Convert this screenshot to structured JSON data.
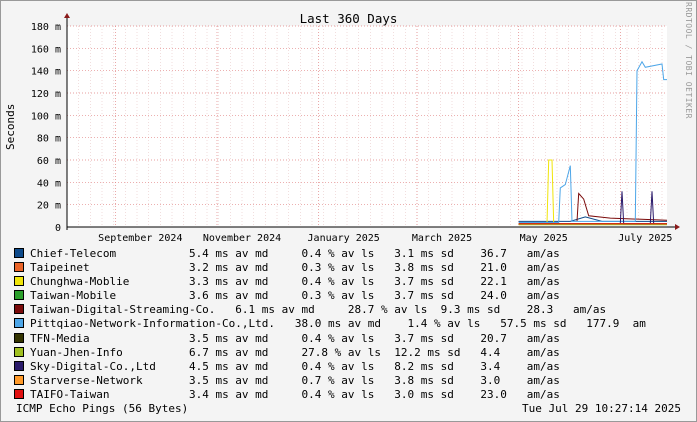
{
  "chart_data": {
    "type": "line",
    "title": "Last 360 Days",
    "ylabel": "Seconds",
    "watermark": "RRDTOOL / TOBI OETIKER",
    "ylim": [
      0,
      180
    ],
    "y_ticks": [
      "0",
      "20 m",
      "40 m",
      "60 m",
      "80 m",
      "100 m",
      "120 m",
      "140 m",
      "160 m",
      "180 m"
    ],
    "x_ticks": [
      "September 2024",
      "November 2024",
      "January 2025",
      "March 2025",
      "May 2025",
      "July 2025"
    ],
    "x_range": [
      "2024-08-03",
      "2025-07-29"
    ],
    "series": [
      {
        "name": "Chief-Telecom",
        "color": "#0e4a8a",
        "stats": {
          "avg": "5.4 ms av md",
          "loss": "0.4 % av ls",
          "sd": "3.1 ms sd",
          "ratio": "36.7",
          "unit": "am/as"
        },
        "points": [
          [
            "2025-05-01",
            5
          ],
          [
            "2025-06-01",
            5
          ],
          [
            "2025-06-10",
            9
          ],
          [
            "2025-06-20",
            5
          ],
          [
            "2025-07-29",
            5
          ]
        ]
      },
      {
        "name": "Taipeinet",
        "color": "#ea6428",
        "stats": {
          "avg": "3.2 ms av md",
          "loss": "0.3 % av ls",
          "sd": "3.8 ms sd",
          "ratio": "21.0",
          "unit": "am/as"
        },
        "points": [
          [
            "2025-05-01",
            3
          ],
          [
            "2025-06-01",
            3
          ],
          [
            "2025-07-29",
            3
          ]
        ]
      },
      {
        "name": "Chunghwa-Moblie",
        "color": "#f0e50a",
        "stats": {
          "avg": "3.3 ms av md",
          "loss": "0.4 % av ls",
          "sd": "3.7 ms sd",
          "ratio": "22.1",
          "unit": "am/as"
        },
        "points": [
          [
            "2025-05-01",
            3
          ],
          [
            "2025-05-18",
            3
          ],
          [
            "2025-05-19",
            60
          ],
          [
            "2025-05-21",
            60
          ],
          [
            "2025-05-22",
            3
          ],
          [
            "2025-07-29",
            3
          ]
        ]
      },
      {
        "name": "Taiwan-Mobile",
        "color": "#2ca02c",
        "stats": {
          "avg": "3.6 ms av md",
          "loss": "0.3 % av ls",
          "sd": "3.7 ms sd",
          "ratio": "24.0",
          "unit": "am/as"
        },
        "points": [
          [
            "2025-05-01",
            3
          ],
          [
            "2025-07-29",
            3
          ]
        ]
      },
      {
        "name": "Taiwan-Digital-Streaming-Co.",
        "color": "#7a0a0a",
        "stats": {
          "avg": "6.1 ms av md",
          "loss": "28.7 % av ls",
          "sd": "9.3 ms sd",
          "ratio": "28.3",
          "unit": "am/as"
        },
        "points": [
          [
            "2025-06-05",
            5
          ],
          [
            "2025-06-06",
            30
          ],
          [
            "2025-06-09",
            25
          ],
          [
            "2025-06-12",
            10
          ],
          [
            "2025-06-25",
            8
          ],
          [
            "2025-07-29",
            6
          ]
        ]
      },
      {
        "name": "Pittqiao-Network-Information-Co.,Ltd.",
        "color": "#4da6e8",
        "stats": {
          "avg": "38.0 ms av md",
          "loss": "1.4 % av ls",
          "sd": "57.5 ms sd",
          "ratio": "177.9",
          "unit": "am"
        },
        "points": [
          [
            "2025-05-01",
            4
          ],
          [
            "2025-05-25",
            4
          ],
          [
            "2025-05-26",
            35
          ],
          [
            "2025-05-29",
            38
          ],
          [
            "2025-06-01",
            55
          ],
          [
            "2025-06-02",
            5
          ],
          [
            "2025-07-10",
            5
          ],
          [
            "2025-07-11",
            140
          ],
          [
            "2025-07-14",
            148
          ],
          [
            "2025-07-16",
            143
          ],
          [
            "2025-07-26",
            146
          ],
          [
            "2025-07-27",
            132
          ],
          [
            "2025-07-29",
            132
          ]
        ]
      },
      {
        "name": "TFN-Media",
        "color": "#333300",
        "stats": {
          "avg": "3.5 ms av md",
          "loss": "0.4 % av ls",
          "sd": "3.7 ms sd",
          "ratio": "20.7",
          "unit": "am/as"
        },
        "points": [
          [
            "2025-05-01",
            3
          ],
          [
            "2025-07-29",
            3
          ]
        ]
      },
      {
        "name": "Yuan-Jhen-Info",
        "color": "#a0c020",
        "stats": {
          "avg": "6.7 ms av md",
          "loss": "27.8 % av ls",
          "sd": "12.2 ms sd",
          "ratio": "4.4",
          "unit": "am/as"
        },
        "points": [
          [
            "2025-05-01",
            2
          ],
          [
            "2025-07-29",
            2
          ]
        ]
      },
      {
        "name": "Sky-Digital-Co.,Ltd",
        "color": "#2a1a6a",
        "stats": {
          "avg": "4.5 ms av md",
          "loss": "0.4 % av ls",
          "sd": "8.2 ms sd",
          "ratio": "3.4",
          "unit": "am/as"
        },
        "points": [
          [
            "2025-07-01",
            3
          ],
          [
            "2025-07-02",
            32
          ],
          [
            "2025-07-03",
            3
          ],
          [
            "2025-07-19",
            3
          ],
          [
            "2025-07-20",
            32
          ],
          [
            "2025-07-21",
            3
          ]
        ]
      },
      {
        "name": "Starverse-Network",
        "color": "#ff9a2a",
        "stats": {
          "avg": "3.5 ms av md",
          "loss": "0.7 % av ls",
          "sd": "3.8 ms sd",
          "ratio": "3.0",
          "unit": "am/as"
        },
        "points": [
          [
            "2025-05-01",
            3
          ],
          [
            "2025-07-29",
            3
          ]
        ]
      },
      {
        "name": "TAIFO-Taiwan",
        "color": "#e01010",
        "stats": {
          "avg": "3.4 ms av md",
          "loss": "0.4 % av ls",
          "sd": "3.0 ms sd",
          "ratio": "23.0",
          "unit": "am/as"
        },
        "points": [
          [
            "2025-05-01",
            3
          ],
          [
            "2025-07-29",
            3
          ]
        ]
      }
    ]
  },
  "footer": {
    "left": "ICMP Echo Pings (56 Bytes)",
    "right": "Tue Jul 29 10:27:14 2025"
  }
}
